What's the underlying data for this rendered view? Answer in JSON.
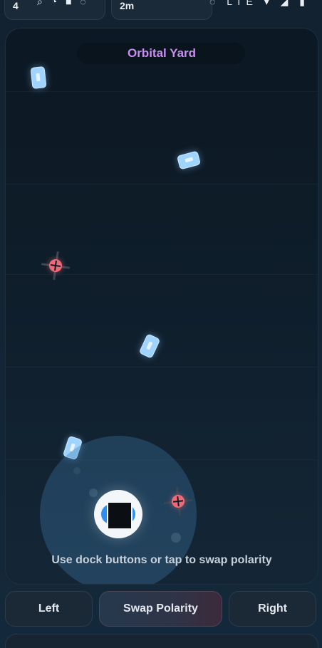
{
  "status_bar": {
    "left_text": "4",
    "mid_text": "2m",
    "left_icons": "⌕ ◔ ■ ◌",
    "right_icons": "◌ LTE ▾ ◢ ▮"
  },
  "game": {
    "title": "Orbital Yard",
    "hint": "Use dock buttons or tap to swap polarity",
    "colors": {
      "title": "#c98ff0",
      "crystal": "#9fd4ff",
      "mine": "#ef6a78",
      "ship": "#2e8ff0"
    }
  },
  "controls": {
    "left_label": "Left",
    "swap_label": "Swap Polarity",
    "right_label": "Right"
  }
}
